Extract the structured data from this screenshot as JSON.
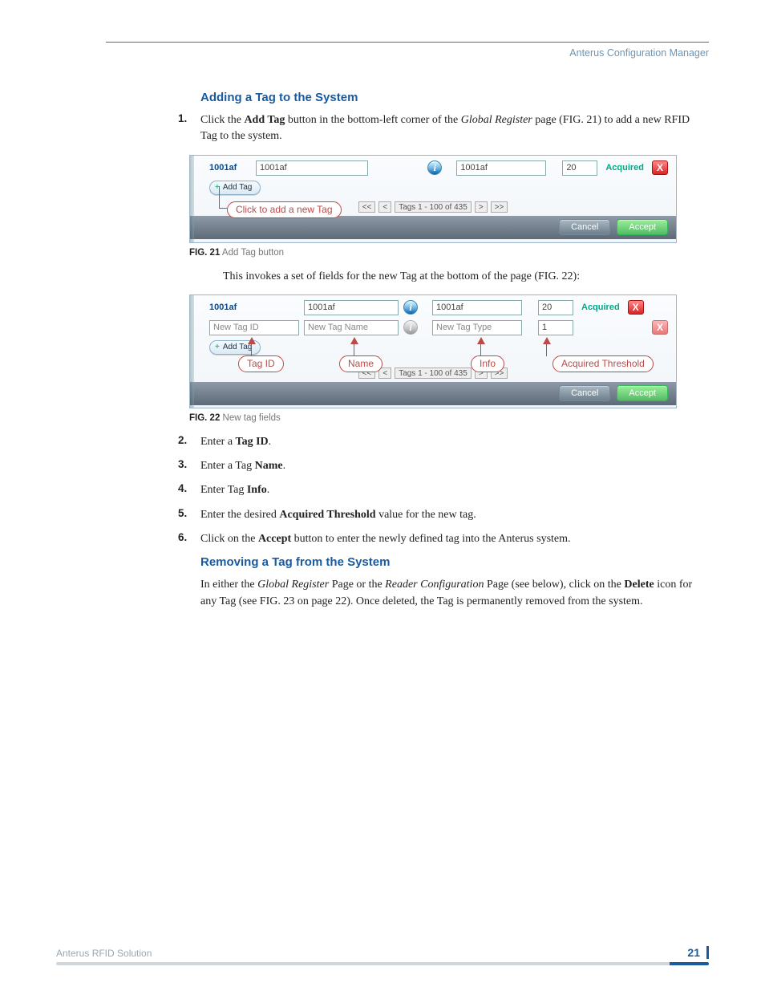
{
  "header": {
    "right": "Anterus Configuration Manager"
  },
  "section1": {
    "title": "Adding a Tag to the System",
    "step1_pre": "Click the ",
    "step1_addtag": "Add Tag",
    "step1_mid": " button in the bottom-left corner of the ",
    "step1_gr": "Global Register",
    "step1_post": " page (FIG. 21) to add a new RFID Tag to the system.",
    "invokes": "This invokes a set of fields for the new Tag at the bottom of the page (FIG. 22):",
    "step2_pre": "Enter a ",
    "step2_b": "Tag ID",
    "step3_pre": "Enter a Tag ",
    "step3_b": "Name",
    "step4_pre": "Enter Tag ",
    "step4_b": "Info",
    "step5_pre": "Enter the desired ",
    "step5_b": "Acquired Threshold",
    "step5_post": " value for the new tag.",
    "step6_pre": "Click on the ",
    "step6_b": "Accept",
    "step6_post": " button to enter the newly defined tag into the Anterus system."
  },
  "section2": {
    "title": "Removing a Tag from the System",
    "p_pre": "In either the ",
    "p_gr": "Global Register",
    "p_mid1": " Page or the ",
    "p_rc": "Reader Configuration",
    "p_mid2": " Page (see below), click on the ",
    "p_del": "Delete",
    "p_post": " icon for any Tag (see FIG. 23 on page 22). Once deleted, the Tag is permanently removed from the system."
  },
  "fig21": {
    "id": "1001af",
    "name": "1001af",
    "info": "1001af",
    "thresh": "20",
    "acquired": "Acquired",
    "addtag": "Add Tag",
    "pager": "Tags 1 - 100 of 435",
    "callout": "Click to add a new Tag",
    "cancel": "Cancel",
    "accept": "Accept",
    "caption_b": "FIG. 21",
    "caption": "  Add Tag button"
  },
  "fig22": {
    "row1": {
      "id": "1001af",
      "name": "1001af",
      "info": "1001af",
      "thresh": "20",
      "acquired": "Acquired"
    },
    "row2": {
      "id_ph": "New Tag ID",
      "name_ph": "New Tag Name",
      "info_ph": "New Tag Type",
      "thresh": "1"
    },
    "addtag": "Add Tag",
    "pager": "Tags 1 - 100 of 435",
    "cancel": "Cancel",
    "accept": "Accept",
    "callouts": {
      "tagid": "Tag ID",
      "name": "Name",
      "info": "Info",
      "at": "Acquired Threshold"
    },
    "caption_b": "FIG. 22",
    "caption": "  New tag fields"
  },
  "footer": {
    "left": "Anterus RFID Solution",
    "page": "21"
  }
}
